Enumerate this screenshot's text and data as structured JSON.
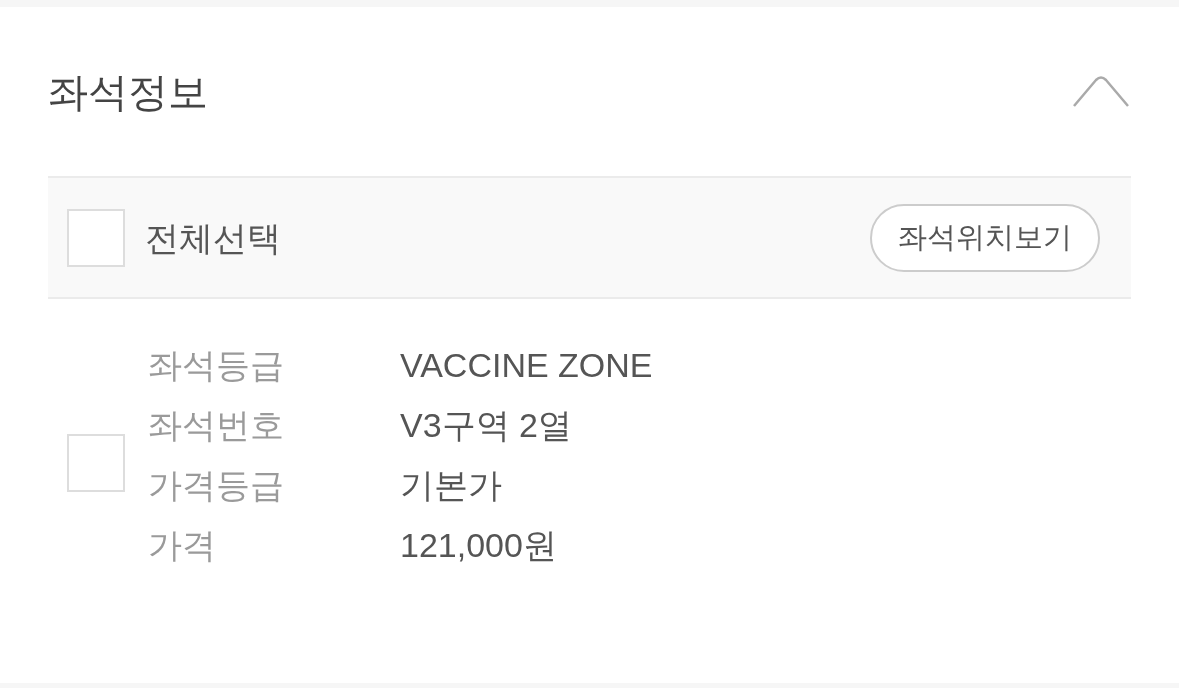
{
  "section": {
    "title": "좌석정보",
    "expanded": true
  },
  "select_all": {
    "label": "전체선택",
    "checked": false
  },
  "seat_map_button": {
    "label": "좌석위치보기"
  },
  "seats": [
    {
      "checked": false,
      "fields": [
        {
          "label": "좌석등급",
          "value": "VACCINE ZONE"
        },
        {
          "label": "좌석번호",
          "value": "V3구역 2열"
        },
        {
          "label": "가격등급",
          "value": "기본가"
        },
        {
          "label": "가격",
          "value": "121,000원"
        }
      ]
    }
  ]
}
